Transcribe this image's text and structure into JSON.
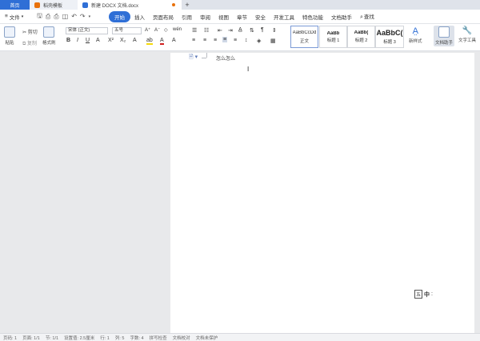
{
  "tabs": {
    "home": "首页",
    "templates": "稻壳模板",
    "document": "新建 DOCX 文档.docx",
    "new_tab": "+"
  },
  "menubar": {
    "file": "文件",
    "items": [
      "开始",
      "插入",
      "页面布局",
      "引用",
      "审阅",
      "视图",
      "章节",
      "安全",
      "开发工具",
      "特色功能",
      "文档助手"
    ],
    "active_index": 0,
    "search": "查找"
  },
  "ribbon": {
    "paste": "粘贴",
    "cut": "剪切",
    "copy": "复制",
    "format_painter": "格式刷",
    "font_name": "宋体 (正文)",
    "font_size": "五号",
    "styles": [
      {
        "preview": "AaBbCcDd",
        "label": "正文"
      },
      {
        "preview": "AaBb",
        "label": "标题 1"
      },
      {
        "preview": "AaBb(",
        "label": "标题 2"
      },
      {
        "preview": "AaBbC(",
        "label": "标题 3"
      }
    ],
    "new_style": "新样式",
    "doc_assistant": "文档助手",
    "text_tools": "文字工具"
  },
  "document": {
    "text": "怎么怎么",
    "ime_mode": "中",
    "ime_indicator": "五"
  },
  "status": {
    "items": [
      "页码: 1",
      "页面: 1/1",
      "节: 1/1",
      "设置值: 2.5厘米",
      "行: 1",
      "列: 5",
      "字数: 4",
      "拼写检查",
      "文档校对",
      "文档未保护"
    ]
  },
  "colors": {
    "accent": "#2f6fd6",
    "tab_bar": "#dfe3ea",
    "canvas": "#e8e9eb",
    "page": "#ffffff"
  }
}
